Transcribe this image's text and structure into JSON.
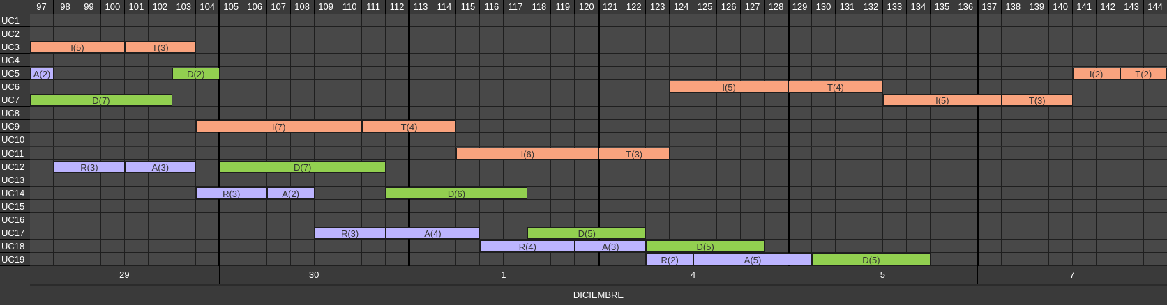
{
  "colors": {
    "I": "#f9a37e",
    "T": "#f9a37e",
    "D": "#92d050",
    "A": "#bcb4ff",
    "R": "#bcb4ff",
    "grid": "#484848",
    "header": "#3a3a3a"
  },
  "periods": [
    "97",
    "98",
    "99",
    "100",
    "101",
    "102",
    "103",
    "104",
    "105",
    "106",
    "107",
    "108",
    "109",
    "110",
    "111",
    "112",
    "113",
    "114",
    "115",
    "116",
    "117",
    "118",
    "119",
    "120",
    "121",
    "122",
    "123",
    "124",
    "125",
    "126",
    "127",
    "128",
    "129",
    "130",
    "131",
    "132",
    "133",
    "134",
    "135",
    "136",
    "137",
    "138",
    "139",
    "140",
    "141",
    "142",
    "143",
    "144"
  ],
  "rows": [
    "UC1",
    "UC2",
    "UC3",
    "UC4",
    "UC5",
    "UC6",
    "UC7",
    "UC8",
    "UC9",
    "UC10",
    "UC11",
    "UC12",
    "UC13",
    "UC14",
    "UC15",
    "UC16",
    "UC17",
    "UC18",
    "UC19"
  ],
  "tasks": [
    {
      "row": 2,
      "start": 97,
      "len": 4,
      "type": "I",
      "label": "I(5)"
    },
    {
      "row": 2,
      "start": 101,
      "len": 3,
      "type": "T",
      "label": "T(3)"
    },
    {
      "row": 4,
      "start": 97,
      "len": 1,
      "type": "A",
      "label": "A(2)"
    },
    {
      "row": 4,
      "start": 103,
      "len": 2,
      "type": "D",
      "label": "D(2)"
    },
    {
      "row": 4,
      "start": 141,
      "len": 2,
      "type": "I",
      "label": "I(2)"
    },
    {
      "row": 4,
      "start": 143,
      "len": 2,
      "type": "T",
      "label": "T(2)"
    },
    {
      "row": 5,
      "start": 124,
      "len": 5,
      "type": "I",
      "label": "I(5)"
    },
    {
      "row": 5,
      "start": 129,
      "len": 4,
      "type": "T",
      "label": "T(4)"
    },
    {
      "row": 6,
      "start": 97,
      "len": 6,
      "type": "D",
      "label": "D(7)"
    },
    {
      "row": 6,
      "start": 133,
      "len": 5,
      "type": "I",
      "label": "I(5)"
    },
    {
      "row": 6,
      "start": 138,
      "len": 3,
      "type": "T",
      "label": "T(3)"
    },
    {
      "row": 8,
      "start": 104,
      "len": 7,
      "type": "I",
      "label": "I(7)"
    },
    {
      "row": 8,
      "start": 111,
      "len": 4,
      "type": "T",
      "label": "T(4)"
    },
    {
      "row": 10,
      "start": 115,
      "len": 6,
      "type": "I",
      "label": "I(6)"
    },
    {
      "row": 10,
      "start": 121,
      "len": 3,
      "type": "T",
      "label": "T(3)"
    },
    {
      "row": 11,
      "start": 98,
      "len": 3,
      "type": "R",
      "label": "R(3)"
    },
    {
      "row": 11,
      "start": 101,
      "len": 3,
      "type": "A",
      "label": "A(3)"
    },
    {
      "row": 11,
      "start": 105,
      "len": 7,
      "type": "D",
      "label": "D(7)"
    },
    {
      "row": 13,
      "start": 104,
      "len": 3,
      "type": "R",
      "label": "R(3)"
    },
    {
      "row": 13,
      "start": 107,
      "len": 2,
      "type": "A",
      "label": "A(2)"
    },
    {
      "row": 13,
      "start": 112,
      "len": 6,
      "type": "D",
      "label": "D(6)"
    },
    {
      "row": 16,
      "start": 109,
      "len": 3,
      "type": "R",
      "label": "R(3)"
    },
    {
      "row": 16,
      "start": 112,
      "len": 4,
      "type": "A",
      "label": "A(4)"
    },
    {
      "row": 16,
      "start": 118,
      "len": 5,
      "type": "D",
      "label": "D(5)"
    },
    {
      "row": 17,
      "start": 116,
      "len": 4,
      "type": "R",
      "label": "R(4)"
    },
    {
      "row": 17,
      "start": 120,
      "len": 3,
      "type": "A",
      "label": "A(3)"
    },
    {
      "row": 17,
      "start": 123,
      "len": 5,
      "type": "D",
      "label": "D(5)"
    },
    {
      "row": 18,
      "start": 123,
      "len": 2,
      "type": "R",
      "label": "R(2)"
    },
    {
      "row": 18,
      "start": 125,
      "len": 5,
      "type": "A",
      "label": "A(5)"
    },
    {
      "row": 18,
      "start": 130,
      "len": 5,
      "type": "D",
      "label": "D(5)"
    }
  ],
  "days": [
    {
      "label": "29",
      "from": 97,
      "to": 104
    },
    {
      "label": "30",
      "from": 105,
      "to": 112
    },
    {
      "label": "1",
      "from": 113,
      "to": 120
    },
    {
      "label": "4",
      "from": 121,
      "to": 128
    },
    {
      "label": "5",
      "from": 129,
      "to": 136
    },
    {
      "label": "7",
      "from": 137,
      "to": 144
    }
  ],
  "month": "DICIEMBRE"
}
